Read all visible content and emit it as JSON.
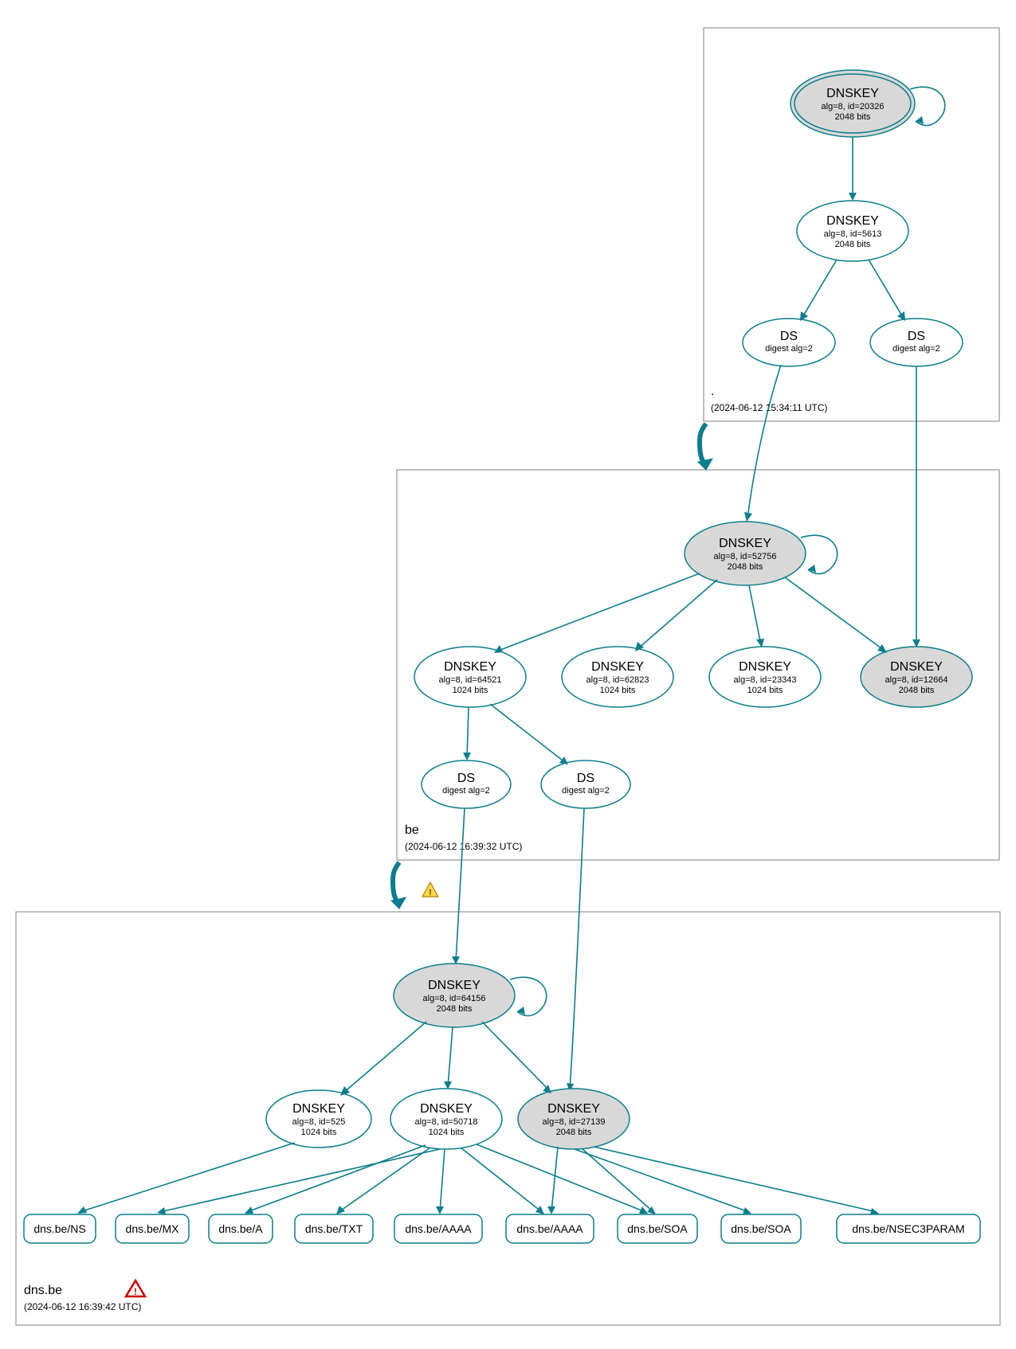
{
  "zones": {
    "root": {
      "name": ".",
      "timestamp": "(2024-06-12 15:34:11 UTC)"
    },
    "be": {
      "name": "be",
      "timestamp": "(2024-06-12 16:39:32 UTC)"
    },
    "dnsbe": {
      "name": "dns.be",
      "timestamp": "(2024-06-12 16:39:42 UTC)"
    }
  },
  "nodes": {
    "root_ksk": {
      "t": "DNSKEY",
      "l1": "alg=8, id=20326",
      "l2": "2048 bits"
    },
    "root_zsk": {
      "t": "DNSKEY",
      "l1": "alg=8, id=5613",
      "l2": "2048 bits"
    },
    "root_ds1": {
      "t": "DS",
      "l1": "digest alg=2",
      "l2": ""
    },
    "root_ds2": {
      "t": "DS",
      "l1": "digest alg=2",
      "l2": ""
    },
    "be_ksk": {
      "t": "DNSKEY",
      "l1": "alg=8, id=52756",
      "l2": "2048 bits"
    },
    "be_z1": {
      "t": "DNSKEY",
      "l1": "alg=8, id=64521",
      "l2": "1024 bits"
    },
    "be_z2": {
      "t": "DNSKEY",
      "l1": "alg=8, id=62823",
      "l2": "1024 bits"
    },
    "be_z3": {
      "t": "DNSKEY",
      "l1": "alg=8, id=23343",
      "l2": "1024 bits"
    },
    "be_z4": {
      "t": "DNSKEY",
      "l1": "alg=8, id=12664",
      "l2": "2048 bits"
    },
    "be_ds1": {
      "t": "DS",
      "l1": "digest alg=2",
      "l2": ""
    },
    "be_ds2": {
      "t": "DS",
      "l1": "digest alg=2",
      "l2": ""
    },
    "dnsbe_ksk": {
      "t": "DNSKEY",
      "l1": "alg=8, id=64156",
      "l2": "2048 bits"
    },
    "dnsbe_z1": {
      "t": "DNSKEY",
      "l1": "alg=8, id=525",
      "l2": "1024 bits"
    },
    "dnsbe_z2": {
      "t": "DNSKEY",
      "l1": "alg=8, id=50718",
      "l2": "1024 bits"
    },
    "dnsbe_z3": {
      "t": "DNSKEY",
      "l1": "alg=8, id=27139",
      "l2": "2048 bits"
    }
  },
  "rrsets": {
    "r0": "dns.be/NS",
    "r1": "dns.be/MX",
    "r2": "dns.be/A",
    "r3": "dns.be/TXT",
    "r4": "dns.be/AAAA",
    "r5": "dns.be/AAAA",
    "r6": "dns.be/SOA",
    "r7": "dns.be/SOA",
    "r8": "dns.be/NSEC3PARAM"
  }
}
